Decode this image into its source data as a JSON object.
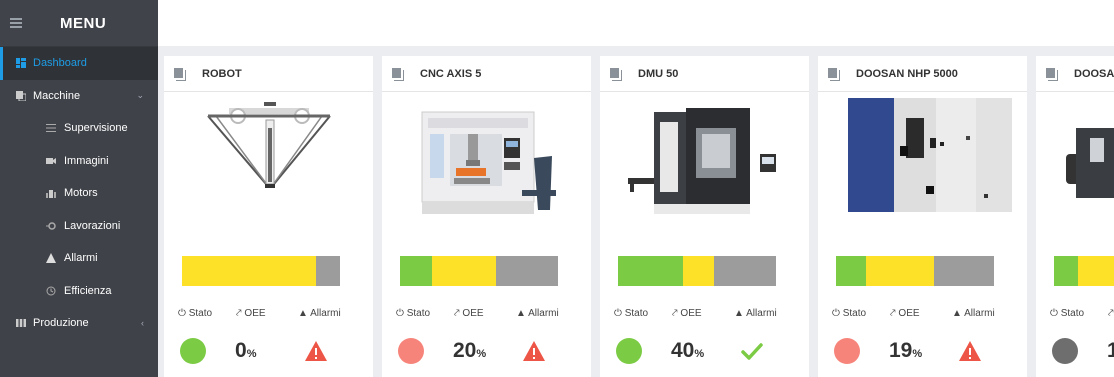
{
  "sidebar": {
    "title": "MENU",
    "items": [
      {
        "label": "Dashboard"
      },
      {
        "label": "Macchine"
      },
      {
        "label": "Supervisione"
      },
      {
        "label": "Immagini"
      },
      {
        "label": "Motors"
      },
      {
        "label": "Lavorazioni"
      },
      {
        "label": "Allarmi"
      },
      {
        "label": "Efficienza"
      },
      {
        "label": "Produzione"
      }
    ]
  },
  "labels": {
    "stato": "Stato",
    "oee": "OEE",
    "allarmi": "Allarmi",
    "pct": "%"
  },
  "colors": {
    "green": "#7ccb44",
    "yellow": "#fde128",
    "grey": "#9c9c9c",
    "red": "#ed5646",
    "salmon": "#f7847a",
    "darkgrey": "#6e6e6e",
    "accent": "#1e9de6"
  },
  "cards": [
    {
      "name": "ROBOT",
      "oee": "0",
      "state": "green-dot",
      "alarm": "alarm-triangle",
      "bar": {
        "green": 0,
        "yellow": 0.845,
        "grey": 0.155
      }
    },
    {
      "name": "CNC AXIS 5",
      "oee": "20",
      "state": "salmon-dot",
      "alarm": "alarm-triangle",
      "bar": {
        "green": 0.2,
        "yellow": 0.41,
        "grey": 0.39
      }
    },
    {
      "name": "DMU 50",
      "oee": "40",
      "state": "green-dot",
      "alarm": "check-mark",
      "bar": {
        "green": 0.41,
        "yellow": 0.2,
        "grey": 0.39
      }
    },
    {
      "name": "DOOSAN NHP 5000",
      "oee": "19",
      "state": "salmon-dot",
      "alarm": "alarm-triangle",
      "bar": {
        "green": 0.19,
        "yellow": 0.43,
        "grey": 0.38
      }
    },
    {
      "name": "DOOSA",
      "oee": "1",
      "state": "grey-dot",
      "alarm": "",
      "bar": {
        "green": 0.15,
        "yellow": 0.85,
        "grey": 0
      }
    }
  ]
}
